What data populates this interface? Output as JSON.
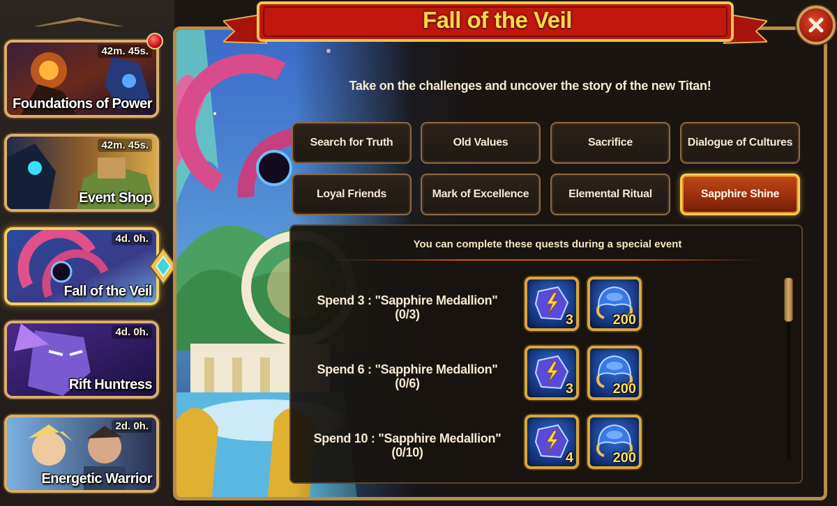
{
  "sidebar": {
    "events": [
      {
        "label": "Foundations of Power",
        "timer": "42m. 45s.",
        "has_notification": true
      },
      {
        "label": "Event Shop",
        "timer": "42m. 45s."
      },
      {
        "label": "Fall of the Veil",
        "timer": "4d. 0h.",
        "active": true
      },
      {
        "label": "Rift Huntress",
        "timer": "4d. 0h."
      },
      {
        "label": "Energetic Warrior",
        "timer": "2d. 0h."
      }
    ]
  },
  "panel": {
    "title": "Fall of the Veil",
    "subtitle": "Take on the challenges and uncover the story of the new Titan!",
    "tabs": [
      {
        "label": "Search for Truth"
      },
      {
        "label": "Old Values"
      },
      {
        "label": "Sacrifice"
      },
      {
        "label": "Dialogue of Cultures"
      },
      {
        "label": "Loyal Friends"
      },
      {
        "label": "Mark of Excellence"
      },
      {
        "label": "Elemental Ritual"
      },
      {
        "label": "Sapphire Shine",
        "active": true
      }
    ],
    "quests_header": "You can complete these quests during a special event",
    "quests": [
      {
        "line1": "Spend 3 : \"Sapphire Medallion\"",
        "progress": "(0/3)",
        "rewards": [
          {
            "icon": "sapphire-medallion-icon",
            "qty": "3"
          },
          {
            "icon": "blue-artifact-icon",
            "qty": "200"
          }
        ]
      },
      {
        "line1": "Spend 6 : \"Sapphire Medallion\"",
        "progress": "(0/6)",
        "rewards": [
          {
            "icon": "sapphire-medallion-icon",
            "qty": "3"
          },
          {
            "icon": "blue-artifact-icon",
            "qty": "200"
          }
        ]
      },
      {
        "line1": "Spend 10 : \"Sapphire Medallion\"",
        "progress": "(0/10)",
        "rewards": [
          {
            "icon": "sapphire-medallion-icon",
            "qty": "4"
          },
          {
            "icon": "blue-artifact-icon",
            "qty": "200"
          }
        ]
      }
    ]
  },
  "colors": {
    "title": "#ffd84a",
    "active_tab": "#b03c12",
    "frame": "#b88c4c",
    "reward_bg": "#1f4ea8"
  }
}
